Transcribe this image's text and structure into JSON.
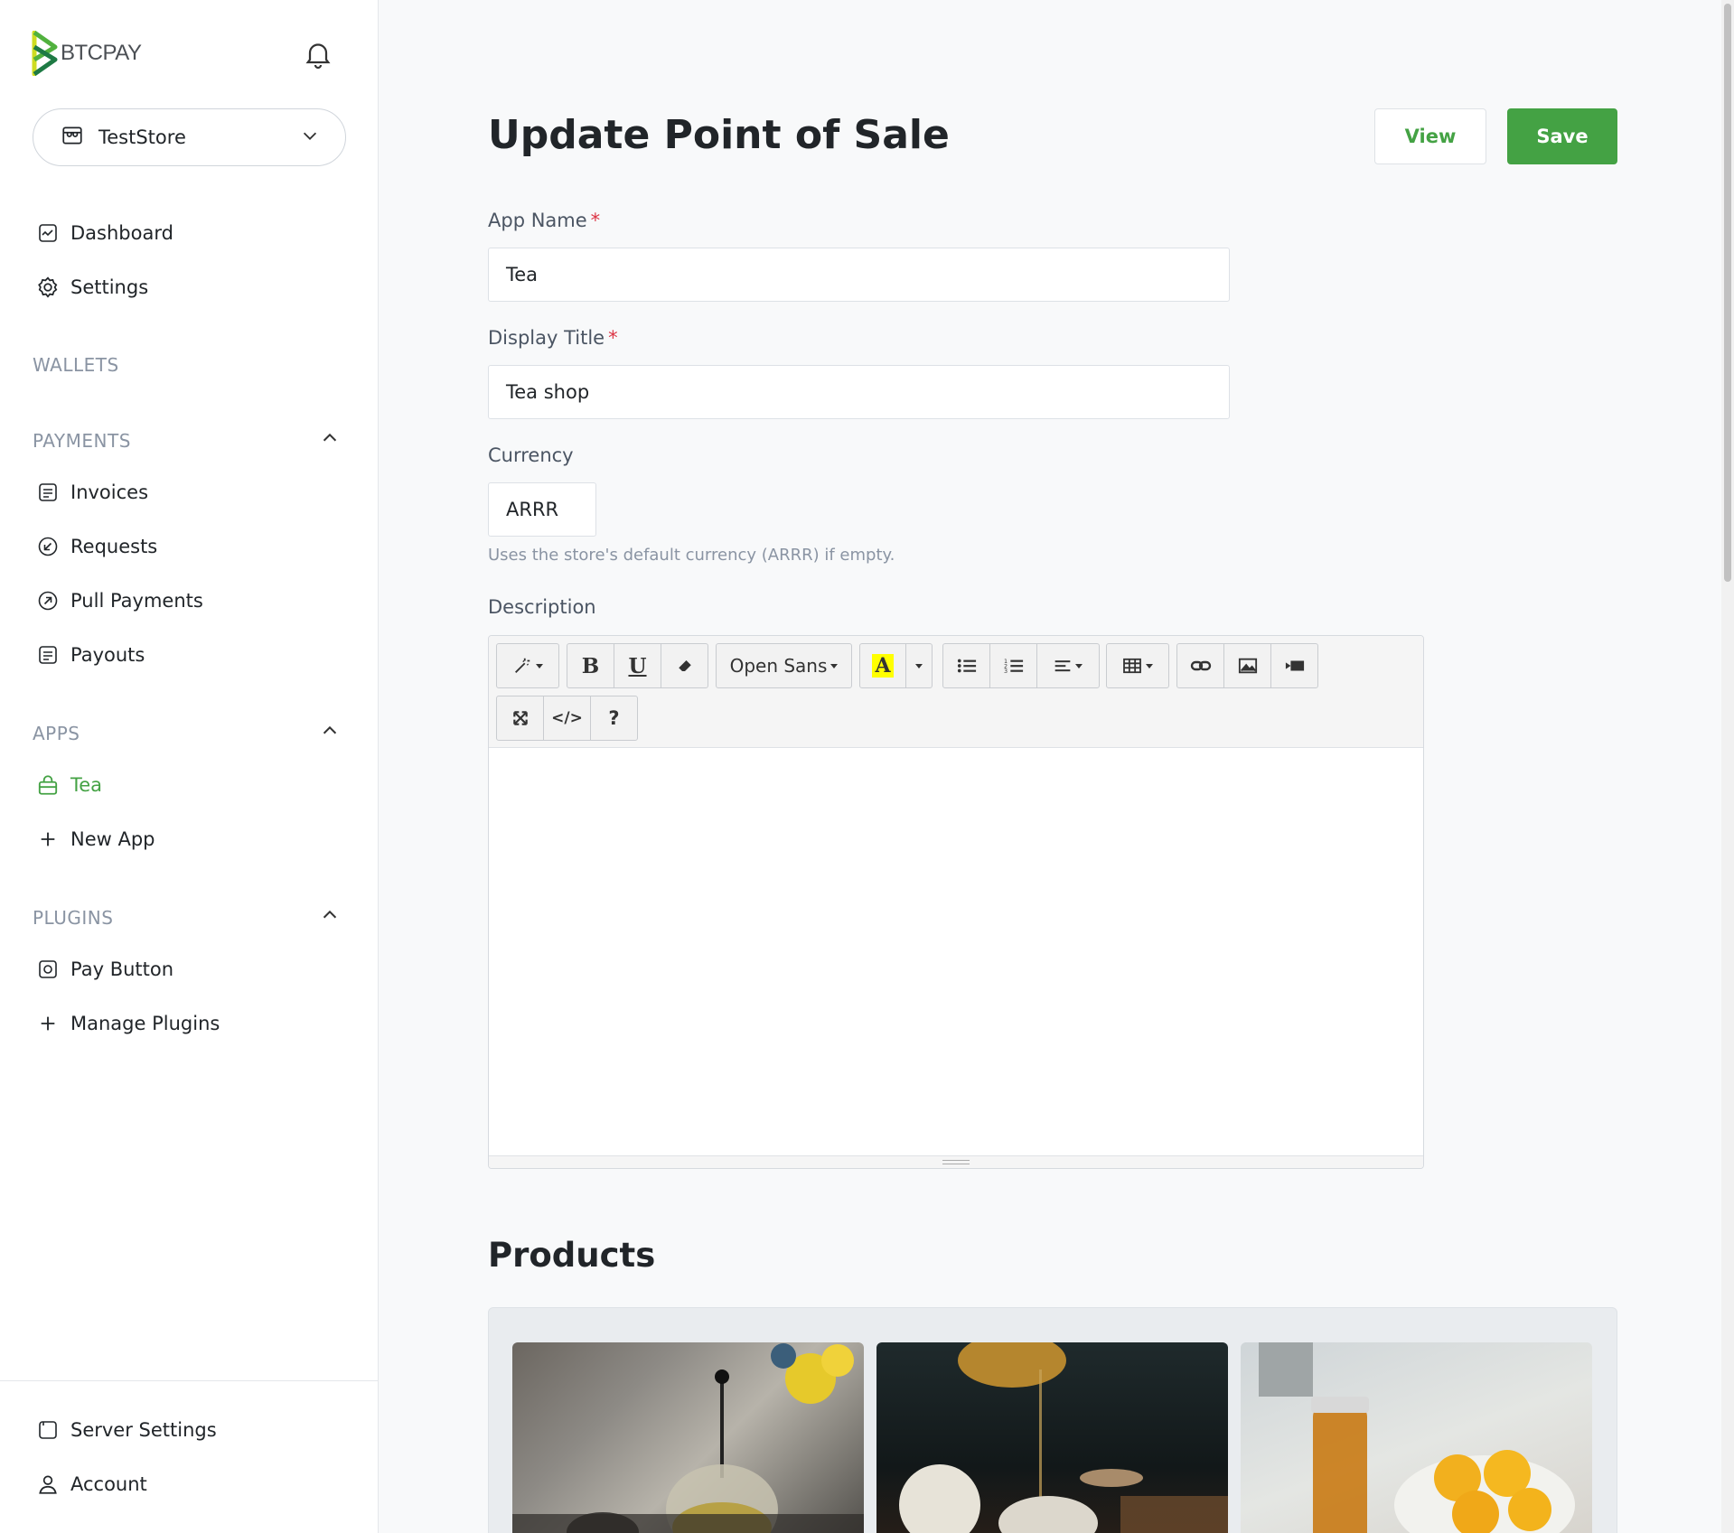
{
  "sidebar": {
    "logo_text": "BTCPAY",
    "store": {
      "name": "TestStore"
    },
    "top_items": [
      {
        "label": "Dashboard",
        "icon": "dashboard-icon"
      },
      {
        "label": "Settings",
        "icon": "gear-icon"
      }
    ],
    "sections": {
      "wallets": "WALLETS",
      "payments": "PAYMENTS",
      "apps": "APPS",
      "plugins": "PLUGINS"
    },
    "payments_items": [
      {
        "label": "Invoices",
        "icon": "invoice-icon"
      },
      {
        "label": "Requests",
        "icon": "request-icon"
      },
      {
        "label": "Pull Payments",
        "icon": "pull-payment-icon"
      },
      {
        "label": "Payouts",
        "icon": "payout-icon"
      }
    ],
    "apps_items": [
      {
        "label": "Tea",
        "icon": "shopping-bag-icon",
        "active": true
      },
      {
        "label": "New App",
        "icon": "plus-icon"
      }
    ],
    "plugins_items": [
      {
        "label": "Pay Button",
        "icon": "pay-button-icon"
      },
      {
        "label": "Manage Plugins",
        "icon": "plus-icon"
      }
    ],
    "footer_items": [
      {
        "label": "Server Settings",
        "icon": "server-icon"
      },
      {
        "label": "Account",
        "icon": "user-icon"
      }
    ]
  },
  "main": {
    "title": "Update Point of Sale",
    "view_label": "View",
    "save_label": "Save",
    "app_name": {
      "label": "App Name",
      "required": "*",
      "value": "Tea"
    },
    "display_title": {
      "label": "Display Title",
      "required": "*",
      "value": "Tea shop"
    },
    "currency": {
      "label": "Currency",
      "value": "ARRR",
      "help": "Uses the store's default currency (ARRR) if empty."
    },
    "description": {
      "label": "Description"
    },
    "editor": {
      "font_name": "Open Sans",
      "bold": "B",
      "underline": "U",
      "code": "</>",
      "help": "?",
      "color_letter": "A"
    },
    "products_title": "Products"
  },
  "colors": {
    "accent": "#44a244",
    "required": "#dc3545",
    "sidebar_bg": "#ffffff",
    "main_bg": "#f8f9fa"
  }
}
